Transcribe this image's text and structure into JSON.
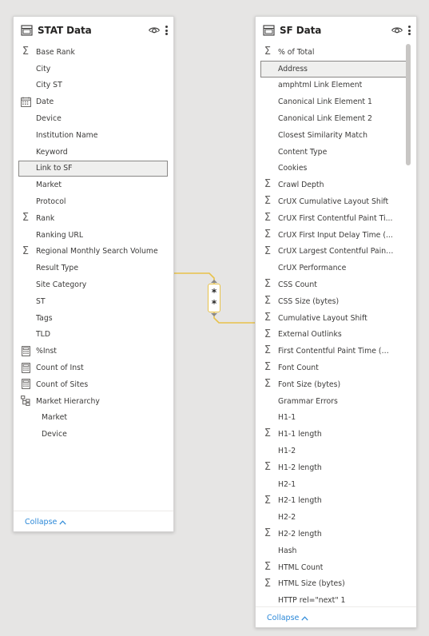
{
  "stat_table": {
    "title": "STAT Data",
    "collapse_label": "Collapse",
    "fields": [
      {
        "label": "Base Rank",
        "icon": "sigma"
      },
      {
        "label": "City",
        "icon": ""
      },
      {
        "label": "City ST",
        "icon": ""
      },
      {
        "label": "Date",
        "icon": "calendar"
      },
      {
        "label": "Device",
        "icon": ""
      },
      {
        "label": "Institution Name",
        "icon": ""
      },
      {
        "label": "Keyword",
        "icon": ""
      },
      {
        "label": "Link to SF",
        "icon": "",
        "selected": true
      },
      {
        "label": "Market",
        "icon": ""
      },
      {
        "label": "Protocol",
        "icon": ""
      },
      {
        "label": "Rank",
        "icon": "sigma"
      },
      {
        "label": "Ranking URL",
        "icon": ""
      },
      {
        "label": "Regional Monthly Search Volume",
        "icon": "sigma"
      },
      {
        "label": "Result Type",
        "icon": ""
      },
      {
        "label": "Site Category",
        "icon": ""
      },
      {
        "label": "ST",
        "icon": ""
      },
      {
        "label": "Tags",
        "icon": ""
      },
      {
        "label": "TLD",
        "icon": ""
      },
      {
        "label": "%Inst",
        "icon": "calculator"
      },
      {
        "label": "Count of Inst",
        "icon": "calculator"
      },
      {
        "label": "Count of Sites",
        "icon": "calculator"
      },
      {
        "label": "Market Hierarchy",
        "icon": "hierarchy"
      },
      {
        "label": "Market",
        "icon": "",
        "child": true
      },
      {
        "label": "Device",
        "icon": "",
        "child": true
      }
    ]
  },
  "sf_table": {
    "title": "SF Data",
    "collapse_label": "Collapse",
    "fields": [
      {
        "label": "% of Total",
        "icon": "sigma"
      },
      {
        "label": "Address",
        "icon": "",
        "selected": true
      },
      {
        "label": "amphtml Link Element",
        "icon": ""
      },
      {
        "label": "Canonical Link Element 1",
        "icon": ""
      },
      {
        "label": "Canonical Link Element 2",
        "icon": ""
      },
      {
        "label": "Closest Similarity Match",
        "icon": ""
      },
      {
        "label": "Content Type",
        "icon": ""
      },
      {
        "label": "Cookies",
        "icon": ""
      },
      {
        "label": "Crawl Depth",
        "icon": "sigma"
      },
      {
        "label": "CrUX Cumulative Layout Shift",
        "icon": "sigma"
      },
      {
        "label": "CrUX First Contentful Paint Ti...",
        "icon": "sigma"
      },
      {
        "label": "CrUX First Input Delay Time (...",
        "icon": "sigma"
      },
      {
        "label": "CrUX Largest Contentful Paint...",
        "icon": "sigma"
      },
      {
        "label": "CrUX Performance",
        "icon": ""
      },
      {
        "label": "CSS Count",
        "icon": "sigma"
      },
      {
        "label": "CSS Size (bytes)",
        "icon": "sigma"
      },
      {
        "label": "Cumulative Layout Shift",
        "icon": "sigma"
      },
      {
        "label": "External Outlinks",
        "icon": "sigma"
      },
      {
        "label": "First Contentful Paint Time (ms)",
        "icon": "sigma"
      },
      {
        "label": "Font Count",
        "icon": "sigma"
      },
      {
        "label": "Font Size (bytes)",
        "icon": "sigma"
      },
      {
        "label": "Grammar Errors",
        "icon": ""
      },
      {
        "label": "H1-1",
        "icon": ""
      },
      {
        "label": "H1-1 length",
        "icon": "sigma"
      },
      {
        "label": "H1-2",
        "icon": ""
      },
      {
        "label": "H1-2 length",
        "icon": "sigma"
      },
      {
        "label": "H2-1",
        "icon": ""
      },
      {
        "label": "H2-1 length",
        "icon": "sigma"
      },
      {
        "label": "H2-2",
        "icon": ""
      },
      {
        "label": "H2-2 length",
        "icon": "sigma"
      },
      {
        "label": "Hash",
        "icon": ""
      },
      {
        "label": "HTML Count",
        "icon": "sigma"
      },
      {
        "label": "HTML Size (bytes)",
        "icon": "sigma"
      },
      {
        "label": "HTTP rel=\"next\" 1",
        "icon": ""
      }
    ]
  },
  "relationship": {
    "from_cardinality": "*",
    "to_cardinality": "*",
    "line_color": "#e8c24a"
  },
  "colors": {
    "canvas": "#e6e5e4",
    "accent_link": "#2b88d8",
    "relationship": "#e8c24a"
  }
}
